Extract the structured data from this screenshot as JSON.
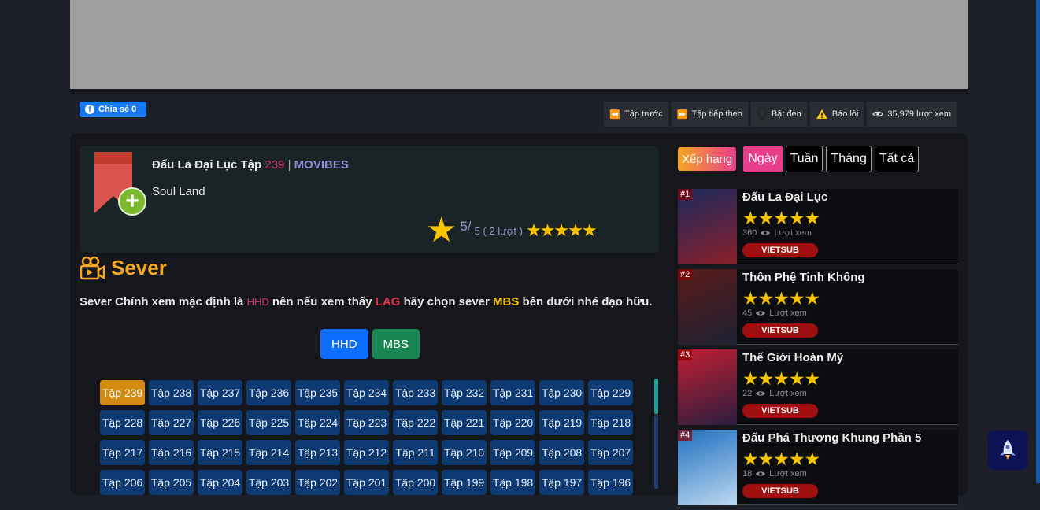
{
  "share": {
    "label": "Chia sẻ 0"
  },
  "toolbar": {
    "prev": "Tập trước",
    "next": "Tập tiếp theo",
    "light": "Bật đèn",
    "report": "Báo lỗi",
    "views": "35,979 lượt xem"
  },
  "info": {
    "title": "Đấu La Đại Lục Tập",
    "episode": "239",
    "separator": "|",
    "brand": "MOVIBES",
    "subtitle": "Soul Land",
    "rating_score": "5/",
    "rating_sub": "5 ( 2 lượt )",
    "rating_value": 5
  },
  "sever": {
    "title": "Sever",
    "notice_1": "Sever Chính xem mặc định là ",
    "notice_hhd": "HHD",
    "notice_2": " nên nếu xem thấy ",
    "notice_lag": "LAG",
    "notice_3": " hãy chọn sever ",
    "notice_mbs": "MBS",
    "notice_4": " bên dưới nhé đạo hữu.",
    "buttons": [
      "HHD",
      "MBS"
    ]
  },
  "episodes": [
    "Tập 239",
    "Tập 238",
    "Tập 237",
    "Tập 236",
    "Tập 235",
    "Tập 234",
    "Tập 233",
    "Tập 232",
    "Tập 231",
    "Tập 230",
    "Tập 229",
    "Tập 228",
    "Tập 227",
    "Tập 226",
    "Tập 225",
    "Tập 224",
    "Tập 223",
    "Tập 222",
    "Tập 221",
    "Tập 220",
    "Tập 219",
    "Tập 218",
    "Tập 217",
    "Tập 216",
    "Tập 215",
    "Tập 214",
    "Tập 213",
    "Tập 212",
    "Tập 211",
    "Tập 210",
    "Tập 209",
    "Tập 208",
    "Tập 207",
    "Tập 206",
    "Tập 205",
    "Tập 204",
    "Tập 203",
    "Tập 202",
    "Tập 201",
    "Tập 200",
    "Tập 199",
    "Tập 198",
    "Tập 197",
    "Tập 196"
  ],
  "ranking": {
    "label": "Xếp hạng",
    "tabs": [
      "Ngày",
      "Tuần",
      "Tháng",
      "Tất cả"
    ],
    "active_tab": "Ngày",
    "items": [
      {
        "rank": "#1",
        "name": "Đấu La Đại Lục",
        "views": "360",
        "views_label": "Lượt xem",
        "badge": "VIETSUB",
        "colors": [
          "#1b2a5e",
          "#8a1f2a"
        ]
      },
      {
        "rank": "#2",
        "name": "Thôn Phệ Tinh Không",
        "views": "45",
        "views_label": "Lượt xem",
        "badge": "VIETSUB",
        "colors": [
          "#5a1a1a",
          "#1e2233"
        ]
      },
      {
        "rank": "#3",
        "name": "Thế Giới Hoàn Mỹ",
        "views": "22",
        "views_label": "Lượt xem",
        "badge": "VIETSUB",
        "colors": [
          "#c21e32",
          "#2a1d3e"
        ]
      },
      {
        "rank": "#4",
        "name": "Đấu Phá Thương Khung Phần 5",
        "views": "18",
        "views_label": "Lượt xem",
        "badge": "VIETSUB",
        "colors": [
          "#1f6fbf",
          "#bcd8f0"
        ]
      }
    ]
  }
}
